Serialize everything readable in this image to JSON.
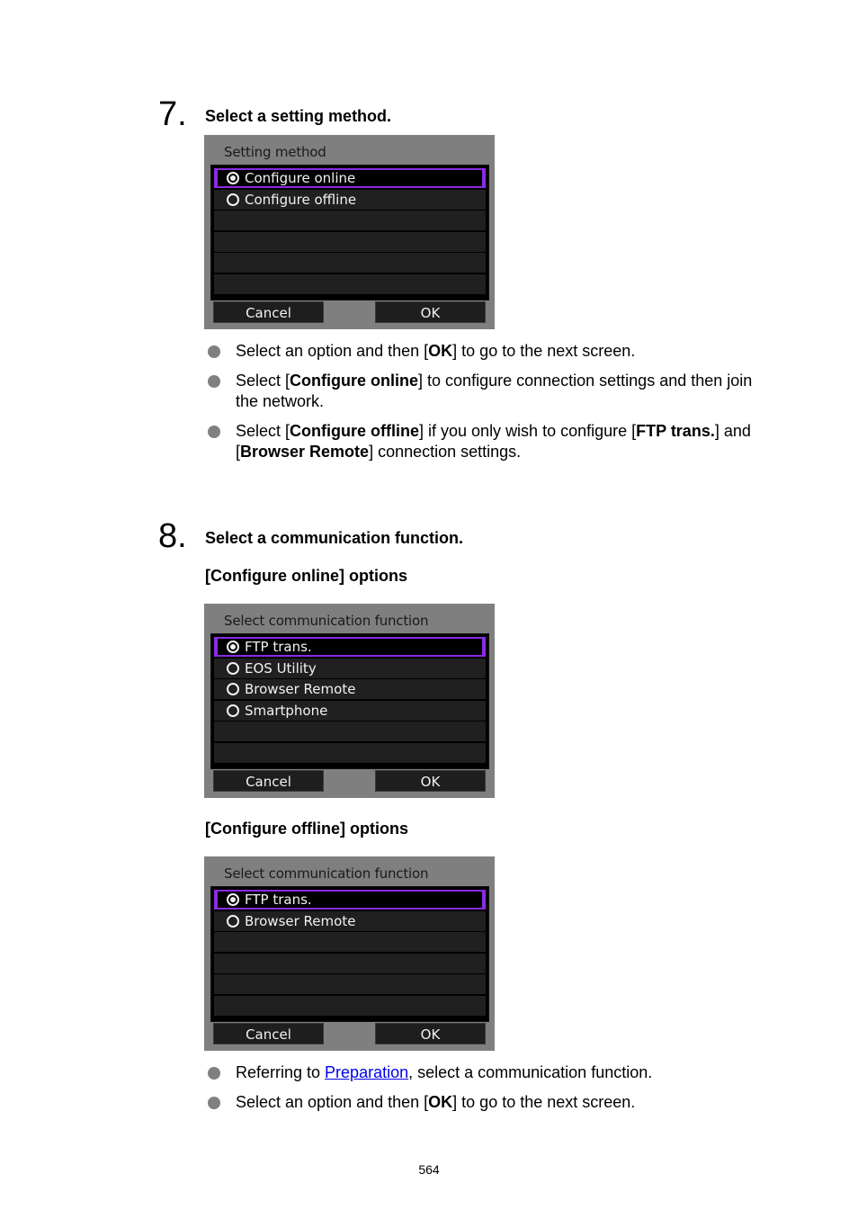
{
  "step7": {
    "number": "7.",
    "title": "Select a setting method.",
    "screen": {
      "title": "Setting method",
      "options": [
        {
          "label": "Configure online",
          "selected": true
        },
        {
          "label": "Configure offline",
          "selected": false
        }
      ],
      "empty_rows": 4,
      "cancel_label": "Cancel",
      "ok_label": "OK"
    },
    "bullets": [
      {
        "parts": [
          {
            "t": "Select an option and then ["
          },
          {
            "t": "OK",
            "b": true
          },
          {
            "t": "] to go to the next screen."
          }
        ]
      },
      {
        "parts": [
          {
            "t": "Select ["
          },
          {
            "t": "Configure online",
            "b": true
          },
          {
            "t": "] to configure connection settings and then join the network."
          }
        ]
      },
      {
        "parts": [
          {
            "t": "Select ["
          },
          {
            "t": "Configure offline",
            "b": true
          },
          {
            "t": "] if you only wish to configure ["
          },
          {
            "t": "FTP trans.",
            "b": true
          },
          {
            "t": "] and ["
          },
          {
            "t": "Browser Remote",
            "b": true
          },
          {
            "t": "] connection settings."
          }
        ]
      }
    ]
  },
  "step8": {
    "number": "8.",
    "title": "Select a communication function.",
    "online_heading": "[Configure online] options",
    "online_screen": {
      "title": "Select communication function",
      "options": [
        {
          "label": "FTP trans.",
          "selected": true
        },
        {
          "label": "EOS Utility",
          "selected": false
        },
        {
          "label": "Browser Remote",
          "selected": false
        },
        {
          "label": "Smartphone",
          "selected": false
        }
      ],
      "empty_rows": 2,
      "cancel_label": "Cancel",
      "ok_label": "OK"
    },
    "offline_heading": "[Configure offline] options",
    "offline_screen": {
      "title": "Select communication function",
      "options": [
        {
          "label": "FTP trans.",
          "selected": true
        },
        {
          "label": "Browser Remote",
          "selected": false
        }
      ],
      "empty_rows": 4,
      "cancel_label": "Cancel",
      "ok_label": "OK"
    },
    "bullets": [
      {
        "parts": [
          {
            "t": "Referring to "
          },
          {
            "t": "Preparation",
            "link": true
          },
          {
            "t": ", select a communication function."
          }
        ]
      },
      {
        "parts": [
          {
            "t": "Select an option and then ["
          },
          {
            "t": "OK",
            "b": true
          },
          {
            "t": "] to go to the next screen."
          }
        ]
      }
    ]
  },
  "colors": {
    "highlight": "#8a2be2",
    "link": "#0000ee",
    "screen_bg": "#7f7f7f",
    "bullet": "#808080"
  },
  "page_number": "564"
}
